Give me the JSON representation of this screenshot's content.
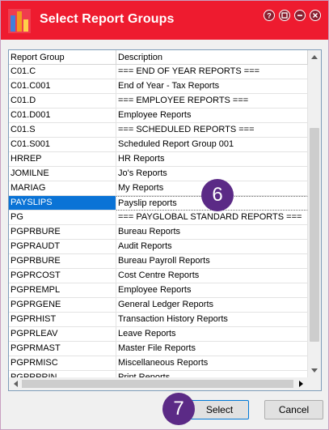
{
  "window": {
    "title": "Select Report Groups",
    "title_color": "#ee1b2f"
  },
  "icons": {
    "app": "bar-chart-icon",
    "help": "help-icon",
    "restore": "restore-icon",
    "minimize": "minimize-icon",
    "close": "close-icon"
  },
  "table": {
    "columns": [
      "Report Group",
      "Description"
    ],
    "selected_index": 9,
    "selected_color": "#0a73d6",
    "rows": [
      {
        "group": "C01.C",
        "description": "=== END OF YEAR REPORTS ==="
      },
      {
        "group": "C01.C001",
        "description": "End of Year - Tax Reports"
      },
      {
        "group": "C01.D",
        "description": "=== EMPLOYEE REPORTS ==="
      },
      {
        "group": "C01.D001",
        "description": "Employee Reports"
      },
      {
        "group": "C01.S",
        "description": "=== SCHEDULED REPORTS ==="
      },
      {
        "group": "C01.S001",
        "description": "Scheduled Report Group 001"
      },
      {
        "group": "HRREP",
        "description": "HR Reports"
      },
      {
        "group": "JOMILNE",
        "description": "Jo's Reports"
      },
      {
        "group": "MARIAG",
        "description": "My Reports"
      },
      {
        "group": "PAYSLIPS",
        "description": "Payslip reports"
      },
      {
        "group": "PG",
        "description": "=== PAYGLOBAL STANDARD REPORTS ==="
      },
      {
        "group": "PGPRBURE",
        "description": "Bureau Reports"
      },
      {
        "group": "PGPRAUDT",
        "description": "Audit Reports"
      },
      {
        "group": "PGPRBURE",
        "description": "Bureau Payroll Reports"
      },
      {
        "group": "PGPRCOST",
        "description": "Cost Centre Reports"
      },
      {
        "group": "PGPREMPL",
        "description": "Employee Reports"
      },
      {
        "group": "PGPRGENE",
        "description": "General Ledger Reports"
      },
      {
        "group": "PGPRHIST",
        "description": "Transaction History Reports"
      },
      {
        "group": "PGPRLEAV",
        "description": "Leave Reports"
      },
      {
        "group": "PGPRMAST",
        "description": "Master File Reports"
      },
      {
        "group": "PGPRMISC",
        "description": "Miscellaneous Reports"
      },
      {
        "group": "PGPRPRIN",
        "description": "Print Reports"
      }
    ]
  },
  "buttons": {
    "select": "Select",
    "cancel": "Cancel"
  },
  "callouts": {
    "step6": "6",
    "step7": "7",
    "color": "#5b2a86"
  }
}
